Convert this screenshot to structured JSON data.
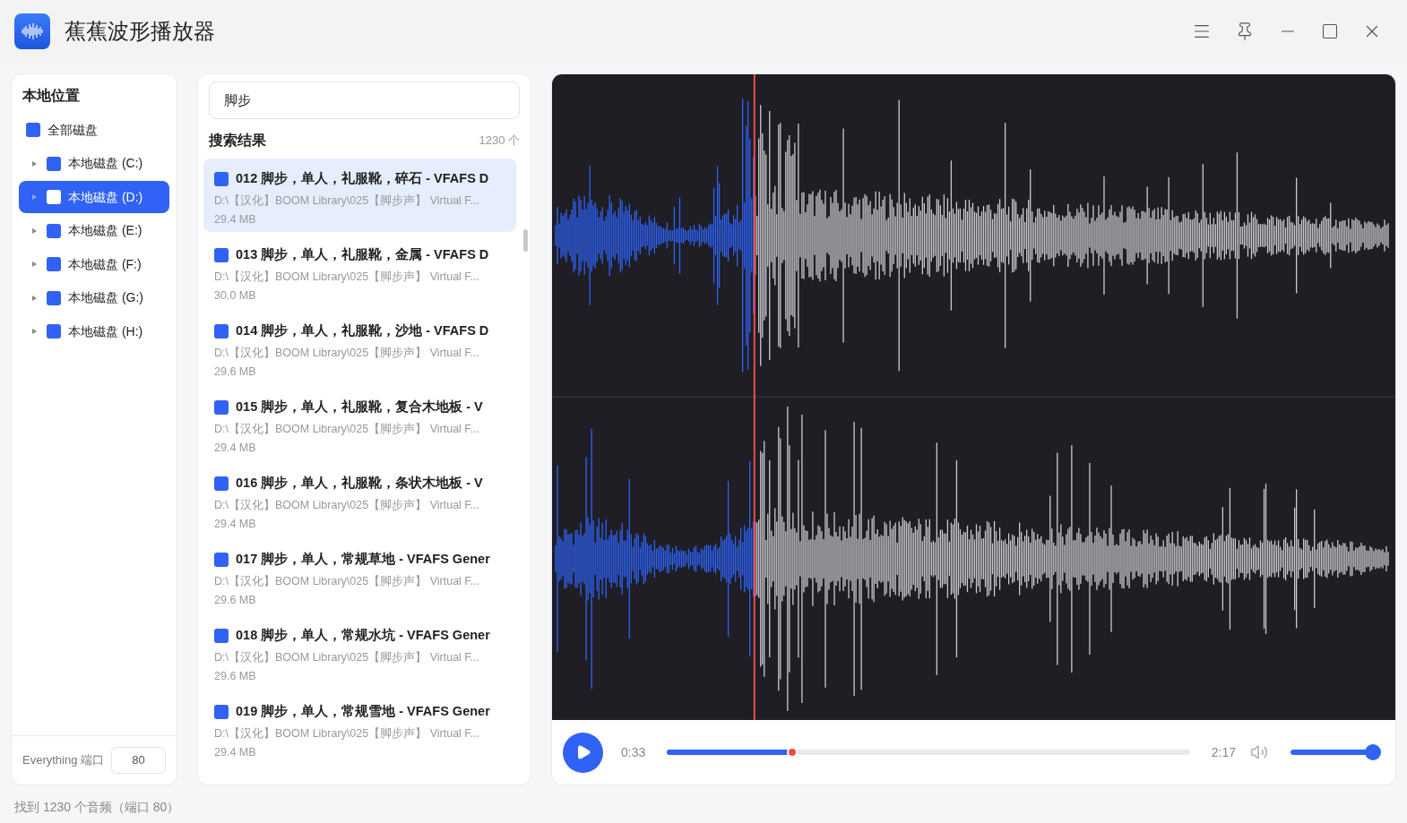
{
  "window": {
    "title": "蕉蕉波形播放器"
  },
  "sidebar": {
    "title": "本地位置",
    "items": [
      {
        "label": "全部磁盘",
        "selected": false,
        "children": [
          {
            "label": "本地磁盘 (C:)",
            "selected": false
          },
          {
            "label": "本地磁盘 (D:)",
            "selected": true
          },
          {
            "label": "本地磁盘 (E:)",
            "selected": false
          },
          {
            "label": "本地磁盘 (F:)",
            "selected": false
          },
          {
            "label": "本地磁盘 (G:)",
            "selected": false
          },
          {
            "label": "本地磁盘 (H:)",
            "selected": false
          }
        ]
      }
    ],
    "port_label": "Everything 端口",
    "port_value": "80"
  },
  "search": {
    "value": "脚步"
  },
  "results": {
    "title": "搜索结果",
    "count": "1230 个",
    "items": [
      {
        "title": "012 脚步，单人，礼服靴，碎石 - VFAFS D",
        "path": "D:\\【汉化】BOOM Library\\025【脚步声】 Virtual F...",
        "size": "29.4 MB",
        "selected": true
      },
      {
        "title": "013 脚步，单人，礼服靴，金属 - VFAFS D",
        "path": "D:\\【汉化】BOOM Library\\025【脚步声】 Virtual F...",
        "size": "30.0 MB",
        "selected": false
      },
      {
        "title": "014 脚步，单人，礼服靴，沙地 - VFAFS D",
        "path": "D:\\【汉化】BOOM Library\\025【脚步声】 Virtual F...",
        "size": "29.6 MB",
        "selected": false
      },
      {
        "title": "015 脚步，单人，礼服靴，复合木地板 - V",
        "path": "D:\\【汉化】BOOM Library\\025【脚步声】 Virtual F...",
        "size": "29.4 MB",
        "selected": false
      },
      {
        "title": "016 脚步，单人，礼服靴，条状木地板 - V",
        "path": "D:\\【汉化】BOOM Library\\025【脚步声】 Virtual F...",
        "size": "29.4 MB",
        "selected": false
      },
      {
        "title": "017 脚步，单人，常规草地 - VFAFS Gener",
        "path": "D:\\【汉化】BOOM Library\\025【脚步声】 Virtual F...",
        "size": "29.6 MB",
        "selected": false
      },
      {
        "title": "018 脚步，单人，常规水坑 - VFAFS Gener",
        "path": "D:\\【汉化】BOOM Library\\025【脚步声】 Virtual F...",
        "size": "29.6 MB",
        "selected": false
      },
      {
        "title": "019 脚步，单人，常规雪地 - VFAFS Gener",
        "path": "D:\\【汉化】BOOM Library\\025【脚步声】 Virtual F...",
        "size": "29.4 MB",
        "selected": false
      }
    ]
  },
  "player": {
    "current": "0:33",
    "duration": "2:17",
    "progress": {
      "level": 0.24
    },
    "volume": {
      "level": 1
    }
  },
  "status_bar": "找到 1230 个音频（端口 80）"
}
